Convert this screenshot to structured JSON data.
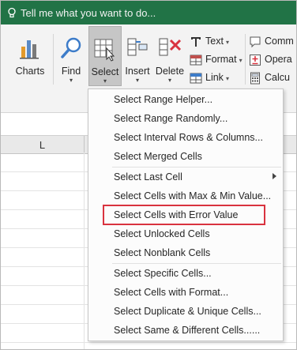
{
  "tell_me": {
    "text": "Tell me what you want to do..."
  },
  "ribbon": {
    "charts": "Charts",
    "find": "Find",
    "select": "Select",
    "insert": "Insert",
    "delete": "Delete",
    "text": "Text",
    "format": "Format",
    "link": "Link",
    "comment": "Comm",
    "operation": "Opera",
    "calculator": "Calcu"
  },
  "sheet": {
    "column_label": "L"
  },
  "menu": {
    "items": [
      "Select Range Helper...",
      "Select Range Randomly...",
      "Select Interval Rows & Columns...",
      "Select Merged Cells",
      "Select Last Cell",
      "Select Cells with Max & Min Value...",
      "Select Cells with Error Value",
      "Select Unlocked Cells",
      "Select Nonblank Cells",
      "Select Specific Cells...",
      "Select Cells with Format...",
      "Select Duplicate & Unique Cells...",
      "Select Same & Different Cells......"
    ],
    "highlighted_index": 6,
    "submenu_index": 4
  },
  "colors": {
    "accent": "#217346",
    "highlight_border": "#d9333f"
  }
}
